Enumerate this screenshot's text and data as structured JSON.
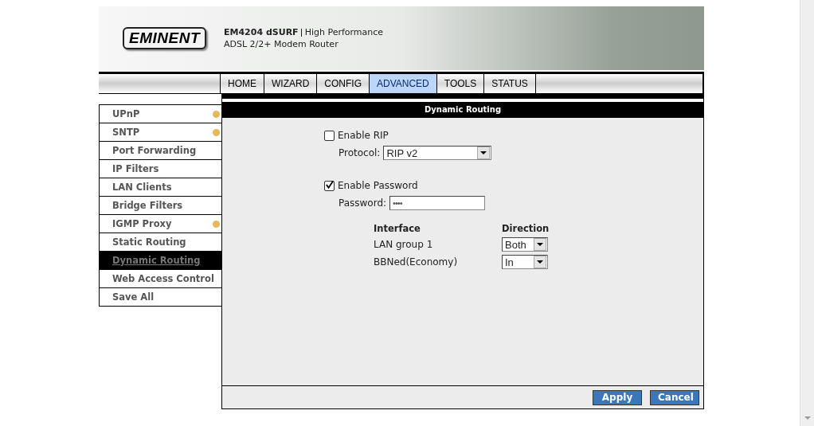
{
  "header": {
    "logo": "EMINENT",
    "model": "EM4204 dSURF",
    "tagline": "High Performance",
    "subtitle": "ADSL 2/2+ Modem Router"
  },
  "tabs": [
    {
      "label": "HOME",
      "selected": false
    },
    {
      "label": "WIZARD",
      "selected": false
    },
    {
      "label": "CONFIG",
      "selected": false
    },
    {
      "label": "ADVANCED",
      "selected": true
    },
    {
      "label": "TOOLS",
      "selected": false
    },
    {
      "label": "STATUS",
      "selected": false
    }
  ],
  "sidebar": {
    "items": [
      {
        "label": "UPnP",
        "selected": false,
        "dot": true
      },
      {
        "label": "SNTP",
        "selected": false,
        "dot": true
      },
      {
        "label": "Port Forwarding",
        "selected": false,
        "dot": false
      },
      {
        "label": "IP Filters",
        "selected": false,
        "dot": false
      },
      {
        "label": "LAN Clients",
        "selected": false,
        "dot": false
      },
      {
        "label": "Bridge Filters",
        "selected": false,
        "dot": false
      },
      {
        "label": "IGMP Proxy",
        "selected": false,
        "dot": true
      },
      {
        "label": "Static Routing",
        "selected": false,
        "dot": false
      },
      {
        "label": "Dynamic Routing",
        "selected": true,
        "dot": false
      },
      {
        "label": "Web Access Control",
        "selected": false,
        "dot": false
      },
      {
        "label": "Save All",
        "selected": false,
        "dot": false
      }
    ]
  },
  "panel": {
    "title": "Dynamic Routing",
    "enable_rip": {
      "label": "Enable RIP",
      "checked": false
    },
    "protocol": {
      "label": "Protocol:",
      "value": "RIP v2"
    },
    "enable_password": {
      "label": "Enable Password",
      "checked": true
    },
    "password": {
      "label": "Password:",
      "value": "••••"
    },
    "interfaces": {
      "columns": [
        "Interface",
        "Direction"
      ],
      "rows": [
        {
          "name": "LAN group 1",
          "direction": "Both"
        },
        {
          "name": "BBNed(Economy)",
          "direction": "In"
        }
      ]
    },
    "buttons": [
      "Apply",
      "Cancel"
    ]
  }
}
